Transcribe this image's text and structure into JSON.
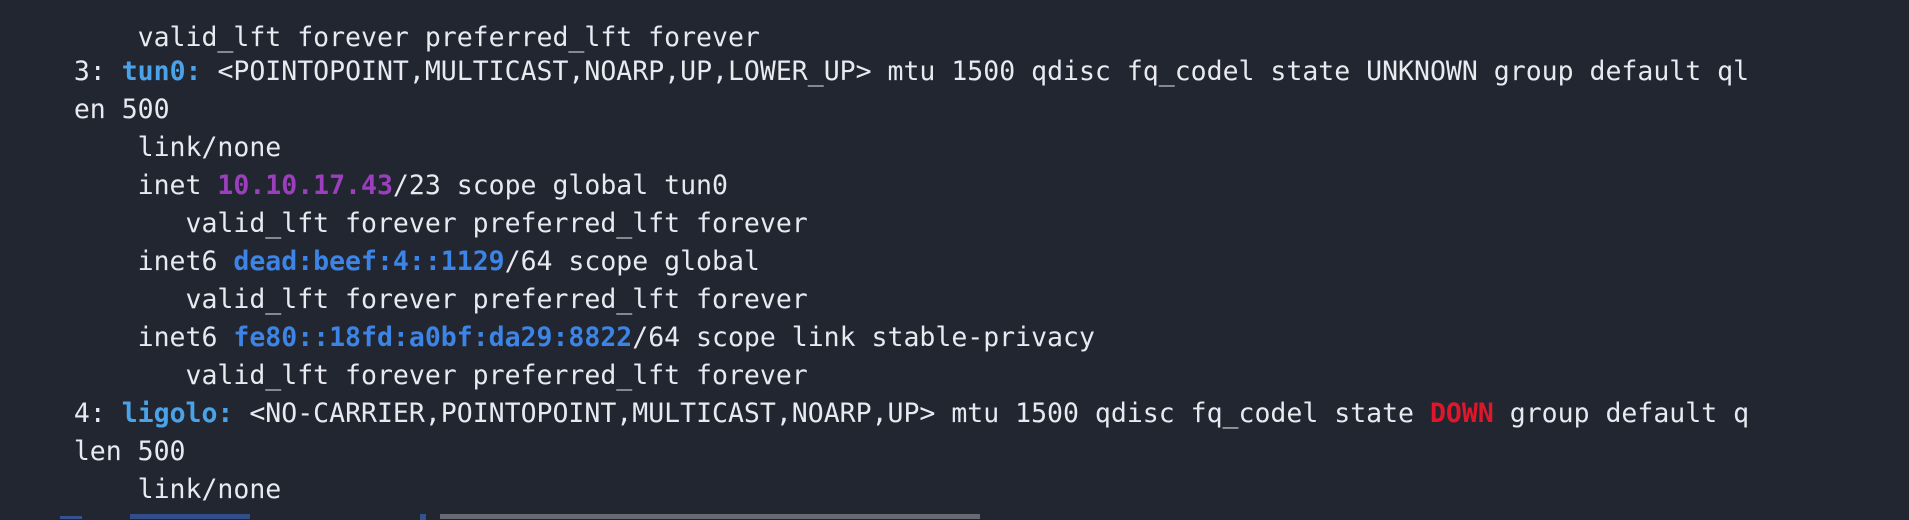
{
  "terminal": {
    "lines": {
      "l0": "    valid_lft forever preferred_lft forever",
      "l1_num": "3: ",
      "l1_iface": "tun0:",
      "l1_rest": " <POINTOPOINT,MULTICAST,NOARP,UP,LOWER_UP> mtu 1500 qdisc fq_codel state UNKNOWN group default ql",
      "l2": "en 500",
      "l3": "    link/none",
      "l4_pre": "    inet ",
      "l4_ip": "10.10.17.43",
      "l4_post": "/23 scope global tun0",
      "l5": "       valid_lft forever preferred_lft forever",
      "l6_pre": "    inet6 ",
      "l6_ip": "dead:beef:4::1129",
      "l6_post": "/64 scope global",
      "l7": "       valid_lft forever preferred_lft forever",
      "l8_pre": "    inet6 ",
      "l8_ip": "fe80::18fd:a0bf:da29:8822",
      "l8_post": "/64 scope link stable-privacy",
      "l9": "       valid_lft forever preferred_lft forever",
      "l10_num": "4: ",
      "l10_iface": "ligolo:",
      "l10_mid": " <NO-CARRIER,POINTOPOINT,MULTICAST,NOARP,UP> mtu 1500 qdisc fq_codel state ",
      "l10_state": "DOWN",
      "l10_post": " group default q",
      "l11": "len 500",
      "l12": "    link/none"
    },
    "colors": {
      "background": "#222631",
      "text": "#e8eaf0",
      "interface": "#4aa3e8",
      "ipv4": "#9b3fbf",
      "ipv6": "#3c84e6",
      "state_down": "#e0162a"
    }
  }
}
